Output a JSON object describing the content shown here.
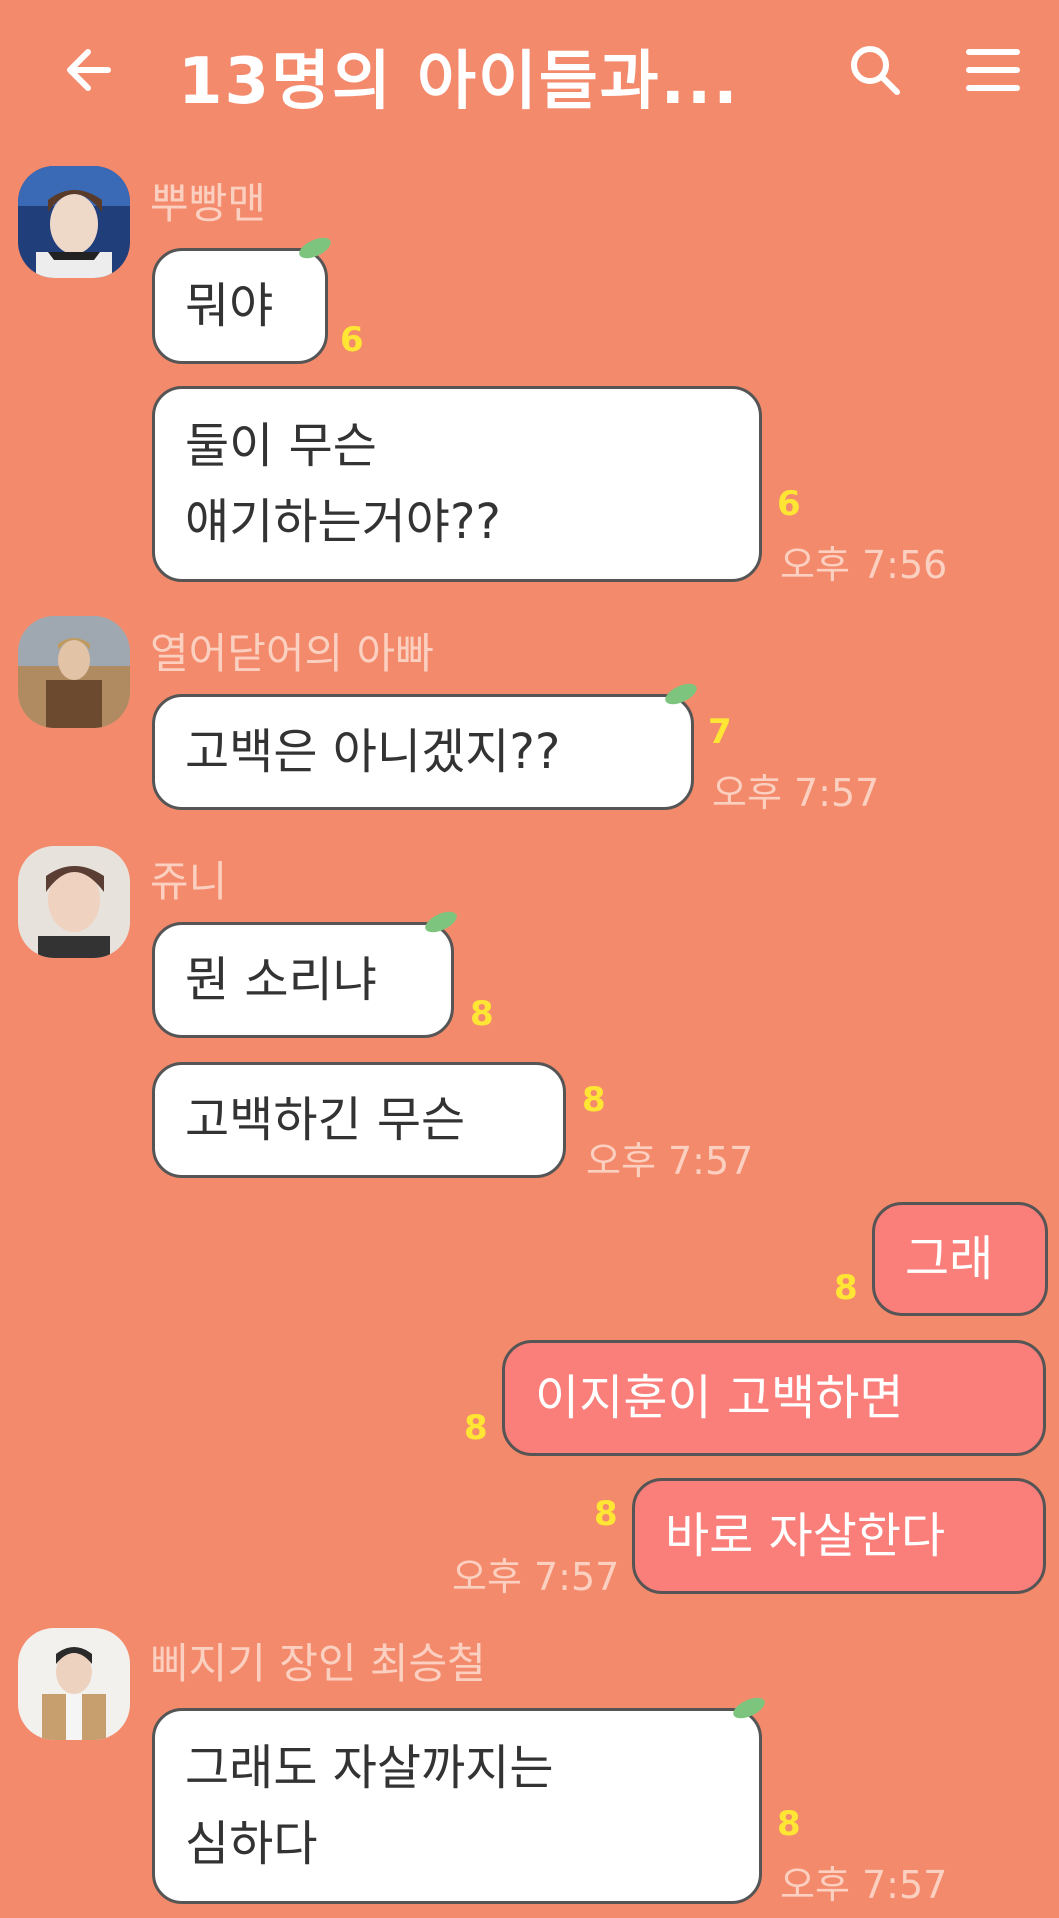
{
  "header": {
    "title": "13명의 아이들과...",
    "back_icon": "arrow-left-icon",
    "search_icon": "search-icon",
    "menu_icon": "hamburger-menu-icon"
  },
  "colors": {
    "background": "#F48A6C",
    "bubble_other": "#FFFFFF",
    "bubble_mine": "#FA7E79",
    "unread_count": "#FFE534",
    "name_and_time": "#FBD0C0"
  },
  "messages": [
    {
      "sender": "뿌빵맨",
      "bubbles": [
        {
          "text": "뭐야",
          "unread": "6"
        },
        {
          "text": "둘이 무슨\n얘기하는거야??",
          "unread": "6"
        }
      ],
      "time": "오후 7:56"
    },
    {
      "sender": "열어닫어의 아빠",
      "bubbles": [
        {
          "text": "고백은 아니겠지??",
          "unread": "7"
        }
      ],
      "time": "오후 7:57"
    },
    {
      "sender": "쥬니",
      "bubbles": [
        {
          "text": "뭔 소리냐",
          "unread": "8"
        },
        {
          "text": "고백하긴 무슨",
          "unread": "8"
        }
      ],
      "time": "오후 7:57"
    },
    {
      "sender": "me",
      "bubbles": [
        {
          "text": "그래",
          "unread": "8"
        },
        {
          "text": "이지훈이 고백하면",
          "unread": "8"
        },
        {
          "text": "바로 자살한다",
          "unread": "8"
        }
      ],
      "time": "오후 7:57"
    },
    {
      "sender": "삐지기 장인 최승철",
      "bubbles": [
        {
          "text": "그래도 자살까지는\n심하다",
          "unread": "8"
        }
      ],
      "time": "오후 7:57"
    }
  ]
}
